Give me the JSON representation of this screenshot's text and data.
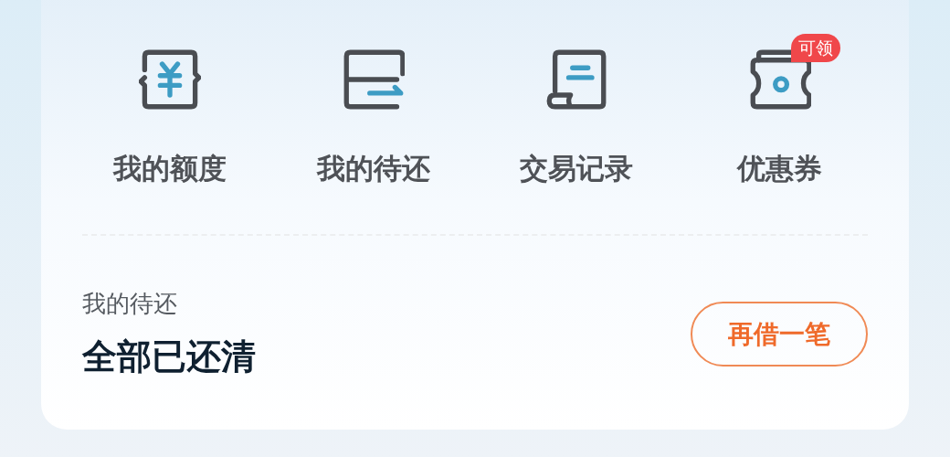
{
  "shortcuts": [
    {
      "kind": "quota",
      "label": "我的额度"
    },
    {
      "kind": "repay",
      "label": "我的待还"
    },
    {
      "kind": "records",
      "label": "交易记录"
    },
    {
      "kind": "coupon",
      "label": "优惠券",
      "badge": "可领"
    }
  ],
  "repayment": {
    "title": "我的待还",
    "status": "全部已还清",
    "button": "再借一笔"
  }
}
